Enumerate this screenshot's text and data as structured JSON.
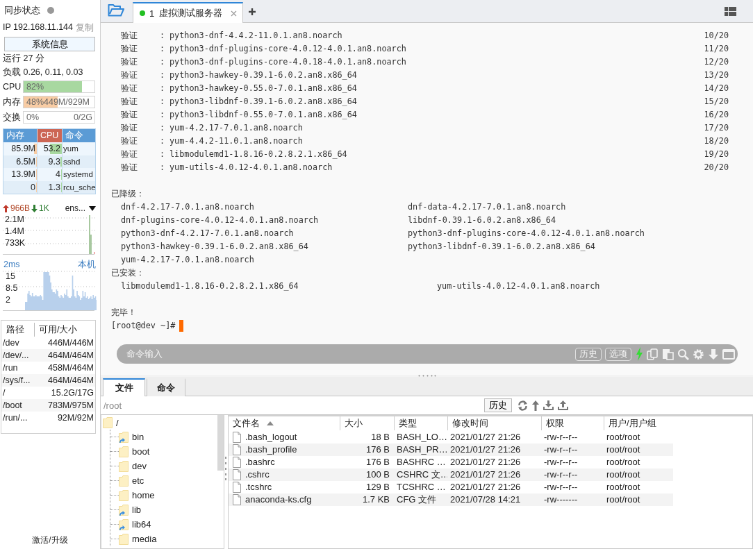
{
  "sidebar": {
    "sync_status": {
      "label": "同步状态",
      "synced": false
    },
    "ip": {
      "text": "IP 192.168.11.144",
      "copy": "复制"
    },
    "system_info_button": "系统信息",
    "uptime": "运行 27 分",
    "load": "负载 0.26, 0.11, 0.03",
    "meters": [
      {
        "label": "CPU",
        "kind": "cpu",
        "text": "82%",
        "level": 0.82
      },
      {
        "label": "内存",
        "kind": "memory",
        "text": "48%449M/929M",
        "level": 0.48
      },
      {
        "label": "交换",
        "kind": "swap",
        "text": "0%",
        "total": "0/2G",
        "level": 0
      }
    ],
    "process_table": {
      "columns": [
        "内存",
        "CPU",
        "命令"
      ],
      "rows": [
        {
          "memory": {
            "text": "85.9M",
            "level": 0.09
          },
          "cpu": {
            "text": "53.2",
            "level": 0.5
          },
          "command": "yum"
        },
        {
          "memory": {
            "text": "6.5M",
            "level": 0.01
          },
          "cpu": {
            "text": "9.3",
            "level": 0.05
          },
          "command": "sshd"
        },
        {
          "memory": {
            "text": "13.9M",
            "level": 0.02
          },
          "cpu": {
            "text": "4",
            "level": 0.04
          },
          "command": "systemd"
        },
        {
          "memory": {
            "text": "0",
            "level": 0
          },
          "cpu": {
            "text": "1.3",
            "level": 0.02
          },
          "command": "rcu_sche"
        }
      ]
    },
    "network": {
      "upload": "966B",
      "download": "1K",
      "interface": "ens...",
      "axis_labels": [
        "2.1M",
        "1.4M",
        "733K"
      ]
    },
    "ping": {
      "latency": "2ms",
      "host": "本机",
      "axis_labels": [
        "15",
        "8.5",
        "2"
      ]
    },
    "disk_table": {
      "columns": [
        "路径",
        "可用/大小"
      ],
      "rows": [
        {
          "path": "/dev",
          "usage": "446M/446M"
        },
        {
          "path": "/dev/...",
          "usage": "464M/464M"
        },
        {
          "path": "/run",
          "usage": "458M/464M"
        },
        {
          "path": "/sys/f...",
          "usage": "464M/464M"
        },
        {
          "path": "/",
          "usage": "15.2G/17G"
        },
        {
          "path": "/boot",
          "usage": "783M/975M"
        },
        {
          "path": "/run/...",
          "usage": "92M/92M"
        }
      ]
    },
    "activate_link": "激活/升级"
  },
  "session_tabs": [
    {
      "number": "1",
      "title": "虚拟测试服务器",
      "connected": true,
      "selected": true
    }
  ],
  "terminal": {
    "lines": [
      {
        "kind": "verify",
        "label": "验证",
        "separator": ":",
        "package": "python3-dnf-4.4.2-11.0.1.an8.noarch",
        "counter": "10/20"
      },
      {
        "kind": "verify",
        "label": "验证",
        "separator": ":",
        "package": "python3-dnf-plugins-core-4.0.12-4.0.1.an8.noarch",
        "counter": "11/20"
      },
      {
        "kind": "verify",
        "label": "验证",
        "separator": ":",
        "package": "python3-dnf-plugins-core-4.0.18-4.0.1.an8.noarch",
        "counter": "12/20"
      },
      {
        "kind": "verify",
        "label": "验证",
        "separator": ":",
        "package": "python3-hawkey-0.39.1-6.0.2.an8.x86_64",
        "counter": "13/20"
      },
      {
        "kind": "verify",
        "label": "验证",
        "separator": ":",
        "package": "python3-hawkey-0.55.0-7.0.1.an8.x86_64",
        "counter": "14/20"
      },
      {
        "kind": "verify",
        "label": "验证",
        "separator": ":",
        "package": "python3-libdnf-0.39.1-6.0.2.an8.x86_64",
        "counter": "15/20"
      },
      {
        "kind": "verify",
        "label": "验证",
        "separator": ":",
        "package": "python3-libdnf-0.55.0-7.0.1.an8.x86_64",
        "counter": "16/20"
      },
      {
        "kind": "verify",
        "label": "验证",
        "separator": ":",
        "package": "yum-4.2.17-7.0.1.an8.noarch",
        "counter": "17/20"
      },
      {
        "kind": "verify",
        "label": "验证",
        "separator": ":",
        "package": "yum-4.4.2-11.0.1.an8.noarch",
        "counter": "18/20"
      },
      {
        "kind": "verify",
        "label": "验证",
        "separator": ":",
        "package": "libmodulemd1-1.8.16-0.2.8.2.1.x86_64",
        "counter": "19/20"
      },
      {
        "kind": "verify",
        "label": "验证",
        "separator": ":",
        "package": "yum-utils-4.0.12-4.0.1.an8.noarch",
        "counter": "20/20"
      },
      {
        "kind": "blank"
      },
      {
        "kind": "heading",
        "text": "已降级："
      },
      {
        "kind": "downgraded_list",
        "items": [
          "dnf-4.2.17-7.0.1.an8.noarch",
          "dnf-data-4.2.17-7.0.1.an8.noarch",
          "dnf-plugins-core-4.0.12-4.0.1.an8.noarch",
          "libdnf-0.39.1-6.0.2.an8.x86_64",
          "python3-dnf-4.2.17-7.0.1.an8.noarch",
          "python3-dnf-plugins-core-4.0.12-4.0.1.an8.noarch",
          "python3-hawkey-0.39.1-6.0.2.an8.x86_64",
          "python3-libdnf-0.39.1-6.0.2.an8.x86_64",
          "yum-4.2.17-7.0.1.an8.noarch"
        ]
      },
      {
        "kind": "heading",
        "text": "已安装："
      },
      {
        "kind": "installed_list",
        "items": [
          "libmodulemd1-1.8.16-0.2.8.2.1.x86_64",
          "yum-utils-4.0.12-4.0.1.an8.noarch"
        ]
      },
      {
        "kind": "blank"
      },
      {
        "kind": "heading",
        "text": "完毕！"
      },
      {
        "kind": "prompt",
        "text": "[root@dev ~]#",
        "cursor": true
      }
    ]
  },
  "command_bar": {
    "placeholder": "命令输入",
    "buttons": [
      "历史",
      "选项"
    ]
  },
  "bottom_tabs": [
    {
      "label": "文件",
      "selected": true
    },
    {
      "label": "命令",
      "selected": false
    }
  ],
  "path_bar": {
    "value": "/root",
    "button": "历史"
  },
  "folder_tree": {
    "name": "/",
    "children": [
      {
        "name": "bin",
        "link": true
      },
      {
        "name": "boot",
        "link": false
      },
      {
        "name": "dev",
        "link": false
      },
      {
        "name": "etc",
        "link": false
      },
      {
        "name": "home",
        "link": false
      },
      {
        "name": "lib",
        "link": true
      },
      {
        "name": "lib64",
        "link": true
      },
      {
        "name": "media",
        "link": false
      }
    ]
  },
  "file_table": {
    "columns": [
      {
        "label": "文件名",
        "sorted": true
      },
      {
        "label": "大小",
        "sorted": false
      },
      {
        "label": "类型",
        "sorted": false
      },
      {
        "label": "修改时间",
        "sorted": false
      },
      {
        "label": "权限",
        "sorted": false
      },
      {
        "label": "用户/用户组",
        "sorted": false
      }
    ],
    "rows": [
      {
        "name": ".bash_logout",
        "size": "18 B",
        "type": "BASH_LO…",
        "modified": "2021/01/27 21:26",
        "permissions": "-rw-r--r--",
        "owner": "root/root"
      },
      {
        "name": ".bash_profile",
        "size": "176 B",
        "type": "BASH_PR…",
        "modified": "2021/01/27 21:26",
        "permissions": "-rw-r--r--",
        "owner": "root/root"
      },
      {
        "name": ".bashrc",
        "size": "176 B",
        "type": "BASHRC …",
        "modified": "2021/01/27 21:26",
        "permissions": "-rw-r--r--",
        "owner": "root/root"
      },
      {
        "name": ".cshrc",
        "size": "100 B",
        "type": "CSHRC 文…",
        "modified": "2021/01/27 21:26",
        "permissions": "-rw-r--r--",
        "owner": "root/root"
      },
      {
        "name": ".tcshrc",
        "size": "129 B",
        "type": "TCSHRC …",
        "modified": "2021/01/27 21:26",
        "permissions": "-rw-r--r--",
        "owner": "root/root"
      },
      {
        "name": "anaconda-ks.cfg",
        "size": "1.7 KB",
        "type": "CFG 文件",
        "modified": "2021/07/28 14:21",
        "permissions": "-rw-------",
        "owner": "root/root"
      }
    ]
  }
}
